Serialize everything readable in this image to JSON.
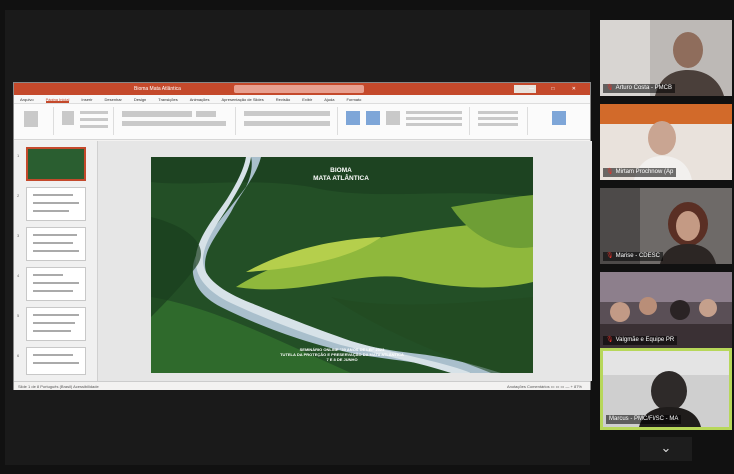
{
  "ppt": {
    "doc_title": "Bioma Mata Atlântica",
    "window_controls": "— □ ✕",
    "tabs": [
      "Arquivo",
      "Página Inicial",
      "Inserir",
      "Desenhar",
      "Design",
      "Transições",
      "Animações",
      "Apresentação de Slides",
      "Revisão",
      "Exibir",
      "Ajuda",
      "Formato"
    ],
    "status_left": "Slide 1 de 8   Português (Brasil)   Acessibilidade",
    "status_right": "Anotações   Comentários   ▭ ▭ ▭   —  +  87%"
  },
  "slide": {
    "title_line1": "BIOMA",
    "title_line2": "MATA ATLÂNTICA",
    "foot_line1": "SEMINÁRIO ONLINE \"30 ANOS DE LEI\" 2023",
    "foot_line2": "TUTELA DA PROTEÇÃO E PRESERVAÇÃO DA MATA ATLÂNTICA",
    "foot_line3": "7 E 8 DE JUNHO"
  },
  "participants": [
    {
      "name": "Arturo Costa - PMCB"
    },
    {
      "name": "Mirtam Prochnow (Ap"
    },
    {
      "name": "Marise - CDESC"
    },
    {
      "name": "Valgmãe e Equipe PR"
    },
    {
      "name": "Marcus - PMC/Fl/SC - MA"
    }
  ],
  "controls": {
    "chevron": "⌄"
  },
  "colors": {
    "ppt_accent": "#c4492b",
    "active_speaker": "#b7d75a",
    "muted_mic": "#e0322b"
  }
}
